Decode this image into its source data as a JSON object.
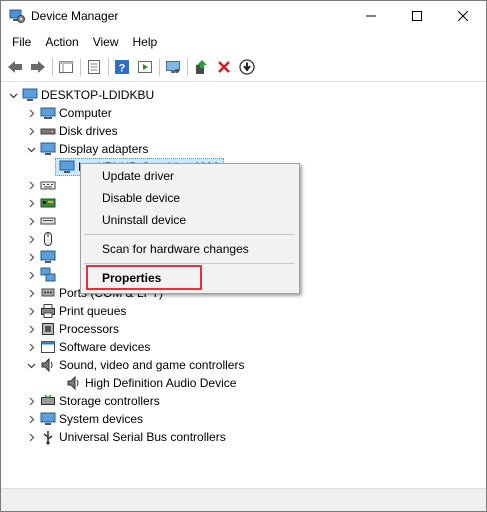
{
  "window": {
    "title": "Device Manager",
    "icon": "device-manager-icon"
  },
  "title_controls": [
    "minimize-icon",
    "maximize-icon",
    "close-icon"
  ],
  "menu": [
    "File",
    "Action",
    "View",
    "Help"
  ],
  "toolbar": [
    "back-arrow-icon",
    "forward-arrow-icon",
    "properties-view-icon",
    "update-list-icon",
    "help-icon",
    "run-icon",
    "scan-monitor-icon",
    "add-driver-icon",
    "uninstall-x-icon",
    "download-circle-icon"
  ],
  "tree": {
    "root": "DESKTOP-LDIDKBU",
    "items": [
      {
        "label": "Computer",
        "icon": "computer-icon",
        "expanded": false
      },
      {
        "label": "Disk drives",
        "icon": "disk-drive-icon",
        "expanded": false
      },
      {
        "label": "Display adapters",
        "icon": "display-adapter-icon",
        "expanded": true
      },
      {
        "label": "Intel(R) HD Graphics 4600",
        "icon": "display-adapter-icon",
        "child": true,
        "selected": true
      },
      {
        "label": "",
        "icon": "keyboard-icon",
        "expanded": false
      },
      {
        "label": "",
        "icon": "network-card-icon",
        "expanded": false
      },
      {
        "label": "",
        "icon": "keyboard-icon",
        "expanded": false
      },
      {
        "label": "",
        "icon": "mouse-icon",
        "expanded": false
      },
      {
        "label": "",
        "icon": "monitor-icon",
        "expanded": false
      },
      {
        "label": "",
        "icon": "network-adapter-icon",
        "expanded": false
      },
      {
        "label": "Ports (COM & LPT)",
        "icon": "port-icon",
        "expanded": false
      },
      {
        "label": "Print queues",
        "icon": "printer-icon",
        "expanded": false
      },
      {
        "label": "Processors",
        "icon": "processor-icon",
        "expanded": false
      },
      {
        "label": "Software devices",
        "icon": "software-device-icon",
        "expanded": false
      },
      {
        "label": "Sound, video and game controllers",
        "icon": "speaker-icon",
        "expanded": true
      },
      {
        "label": "High Definition Audio Device",
        "icon": "speaker-icon",
        "child": true
      },
      {
        "label": "Storage controllers",
        "icon": "storage-icon",
        "expanded": false
      },
      {
        "label": "System devices",
        "icon": "system-device-icon",
        "expanded": false
      },
      {
        "label": "Universal Serial Bus controllers",
        "icon": "usb-icon",
        "expanded": false
      }
    ]
  },
  "context_menu": {
    "update_driver": "Update driver",
    "disable_device": "Disable device",
    "uninstall_device": "Uninstall device",
    "scan": "Scan for hardware changes",
    "properties": "Properties"
  },
  "colors": {
    "highlight_box": "#e0333c",
    "selection": "#cce8ff",
    "accent_blue": "#1e73c8"
  }
}
